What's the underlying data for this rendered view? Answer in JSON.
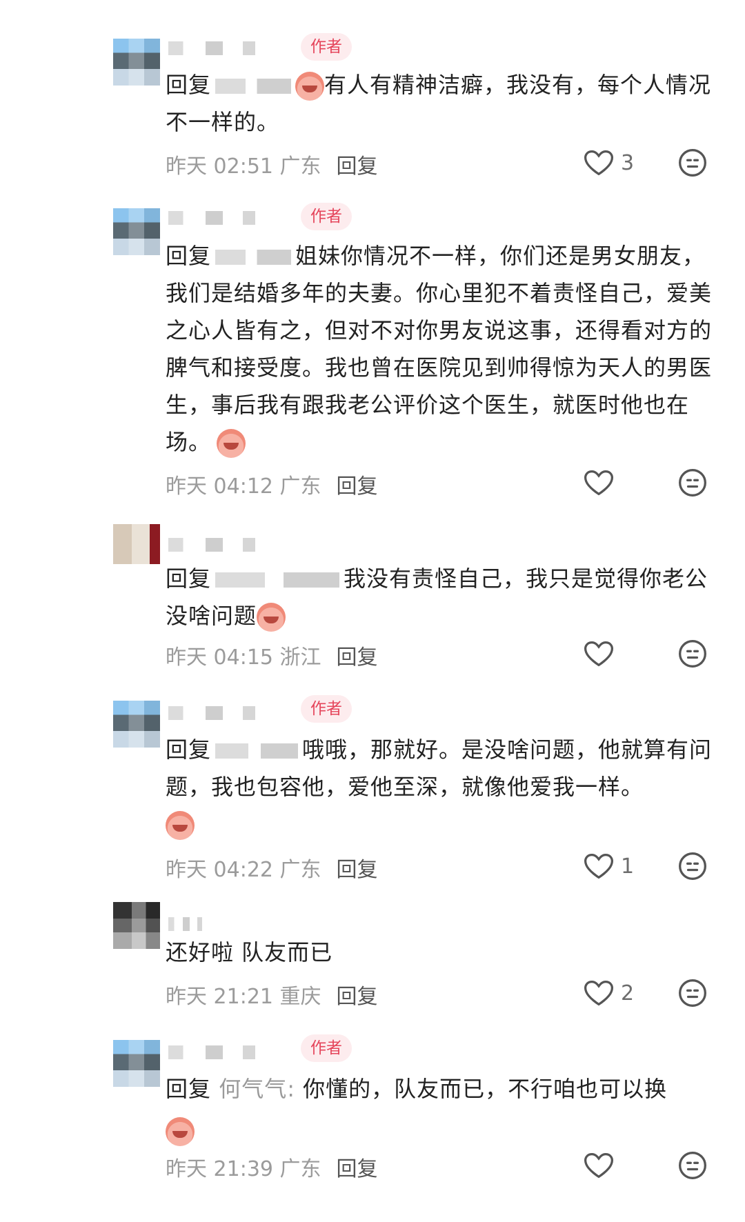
{
  "author_badge": "作者",
  "reply_label": "回复",
  "comments": [
    {
      "reply_prefix": "回复",
      "reply_target": "",
      "text": "有人有精神洁癖，我没有，每个人情况不一样的。",
      "time": "昨天 02:51 广东",
      "reply_action": "回复",
      "likes": "3"
    },
    {
      "reply_prefix": "回复",
      "reply_target": "",
      "text": "姐妹你情况不一样，你们还是男女朋友，我们是结婚多年的夫妻。你心里犯不着责怪自己，爱美之心人皆有之，但对不对你男友说这事，还得看对方的脾气和接受度。我也曾在医院见到帅得惊为天人的男医生，事后我有跟我老公评价这个医生，就医时他也在场。",
      "time": "昨天 04:12 广东",
      "reply_action": "回复",
      "likes": ""
    },
    {
      "reply_prefix": "回复",
      "reply_target": "",
      "text": "我没有责怪自己，我只是觉得你老公没啥问题",
      "time": "昨天 04:15 浙江",
      "reply_action": "回复",
      "likes": ""
    },
    {
      "reply_prefix": "回复",
      "reply_target": "",
      "text": "哦哦，那就好。是没啥问题，他就算有问题，我也包容他，爱他至深，就像他爱我一样。",
      "time": "昨天 04:22 广东",
      "reply_action": "回复",
      "likes": "1"
    },
    {
      "reply_prefix": "",
      "reply_target": "",
      "text": "还好啦 队友而已",
      "time": "昨天 21:21 重庆",
      "reply_action": "回复",
      "likes": "2"
    },
    {
      "reply_prefix": "回复",
      "reply_target": "何气气:",
      "text": "你懂的，队友而已，不行咱也可以换",
      "time": "昨天 21:39 广东",
      "reply_action": "回复",
      "likes": ""
    }
  ]
}
